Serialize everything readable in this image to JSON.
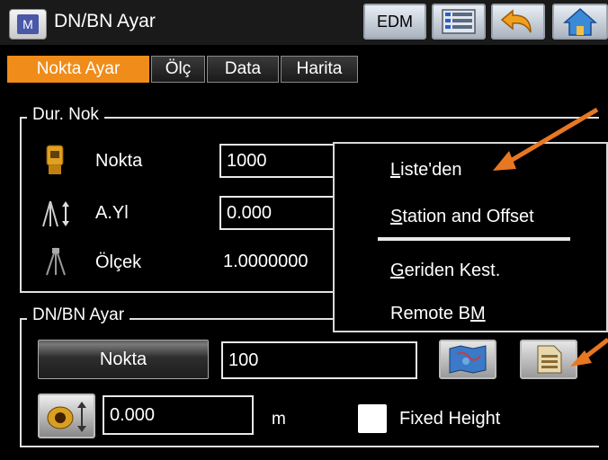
{
  "title": "DN/BN Ayar",
  "app_icon_letter": "M",
  "toolbar": {
    "edm_label": "EDM"
  },
  "tabs": [
    {
      "label": "Nokta Ayar",
      "active": true
    },
    {
      "label": "Ölç"
    },
    {
      "label": "Data"
    },
    {
      "label": "Harita"
    }
  ],
  "station_group": {
    "label": "Dur. Nok",
    "rows": [
      {
        "label": "Nokta",
        "value": "1000"
      },
      {
        "label": "A.Yl",
        "value": "0.000"
      },
      {
        "label": "Ölçek",
        "value": "1.0000000"
      }
    ]
  },
  "menu": {
    "items": [
      "Liste'den",
      "Station and Offset",
      "Geriden Kest.",
      "Remote BM"
    ]
  },
  "bs_group": {
    "label": "DN/BN Ayar",
    "point_button": "Nokta",
    "point_value": "100",
    "height_value": "0.000",
    "unit": "m",
    "fixed_height_label": "Fixed Height",
    "fixed_height_checked": false
  },
  "colors": {
    "accent": "#f08c1a",
    "arrow": "#e87722"
  }
}
